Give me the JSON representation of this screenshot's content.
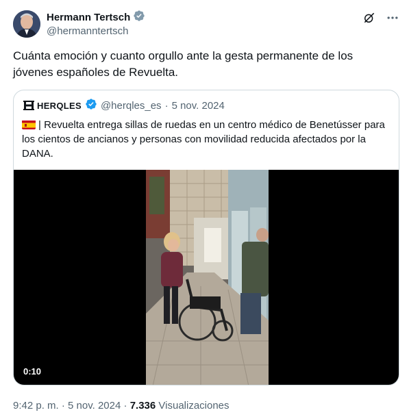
{
  "author": {
    "name": "Hermann Tertsch",
    "handle": "@hermanntertsch",
    "verified_color": "#829aab"
  },
  "tweet": {
    "text": "Cuánta emoción y cuanto orgullo ante la gesta permanente de los jóvenes españoles de Revuelta."
  },
  "icons": {
    "grok": "grok-icon",
    "more": "more-icon"
  },
  "quote": {
    "brand": "HERQLES",
    "handle": "@herqles_es",
    "separator": "·",
    "date": "5 nov. 2024",
    "text": "| Revuelta entrega sillas de ruedas en un centro médico de Benetússer para los cientos de ancianos y personas con movilidad reducida afectados por la DANA.",
    "verified_color": "#1d9bf0",
    "video": {
      "duration": "0:10"
    }
  },
  "meta": {
    "time": "9:42 p. m.",
    "sep1": "·",
    "date": "5 nov. 2024",
    "sep2": "·",
    "views": "7.336",
    "views_label": "Visualizaciones"
  }
}
